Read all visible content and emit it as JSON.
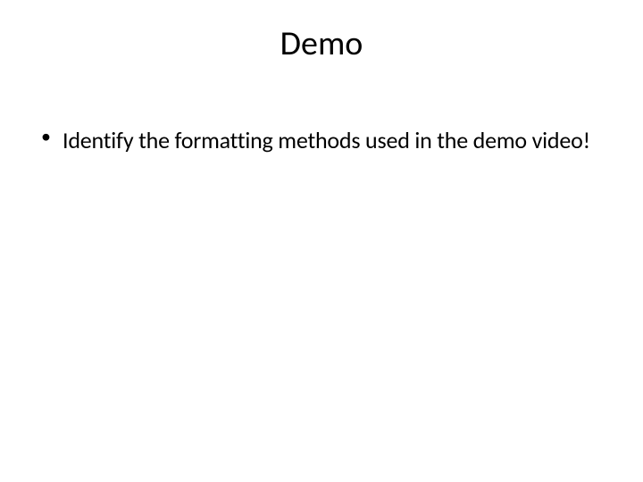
{
  "title": "Demo",
  "bullets": [
    {
      "text": "Identify the formatting methods used in the demo video!"
    }
  ]
}
